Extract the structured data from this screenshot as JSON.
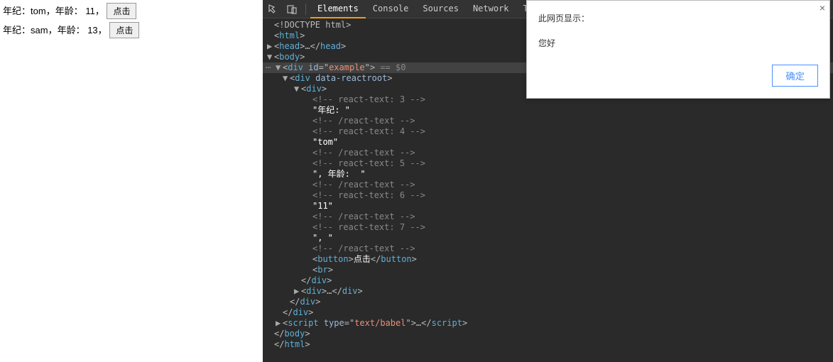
{
  "page": {
    "rows": [
      {
        "name_label": "年纪：",
        "name": "tom",
        "age_label": "，年龄：",
        "age": " 11",
        "sep": "，",
        "button": "点击"
      },
      {
        "name_label": "年纪：",
        "name": "sam",
        "age_label": "，年龄：",
        "age": " 13",
        "sep": "，",
        "button": "点击"
      }
    ]
  },
  "devtools": {
    "tabs": {
      "elements": "Elements",
      "console": "Console",
      "sources": "Sources",
      "network": "Network",
      "timeline": "Timeline"
    },
    "dom": {
      "doctype": "<!DOCTYPE html>",
      "html_open": "<html>",
      "head": "<head>…</head>",
      "body_open": "<body>",
      "div_example": "<div id=\"example\"> == $0",
      "reactroot": "<div data-reactroot>",
      "inner_div_open": "<div>",
      "lines": [
        "<!-- react-text: 3 -->",
        "\"年纪: \"",
        "<!-- /react-text -->",
        "<!-- react-text: 4 -->",
        "\"tom\"",
        "<!-- /react-text -->",
        "<!-- react-text: 5 -->",
        "\", 年龄:  \"",
        "<!-- /react-text -->",
        "<!-- react-text: 6 -->",
        "\"11\"",
        "<!-- /react-text -->",
        "<!-- react-text: 7 -->",
        "\", \"",
        "<!-- /react-text -->"
      ],
      "button": "<button>点击</button>",
      "br": "<br>",
      "inner_div_close": "</div>",
      "second_div": "<div>…</div>",
      "reactroot_close": "</div>",
      "example_close": "</div>",
      "script": "<script type=\"text/babel\">…</script",
      "script_end": ">",
      "body_close": "</body>",
      "html_close": "</html>"
    }
  },
  "dialog": {
    "title": "此网页显示：",
    "message": "您好",
    "ok": "确定"
  }
}
